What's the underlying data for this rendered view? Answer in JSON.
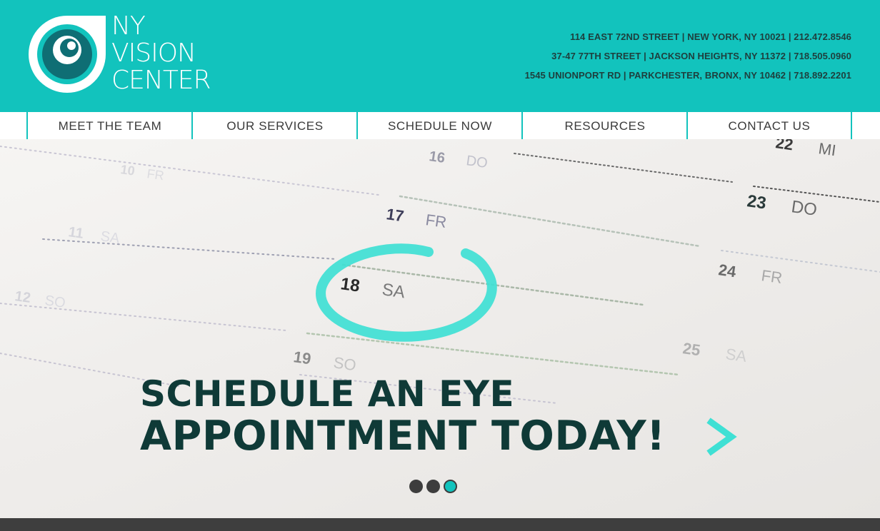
{
  "brand": {
    "line1": "NY",
    "line2": "VISION",
    "line3": "CENTER",
    "primary_color": "#12c3bd",
    "dark_teal": "#0f6e74"
  },
  "addresses": [
    "114 EAST 72ND STREET | NEW YORK, NY 10021 | 212.472.8546",
    "37-47 77TH STREET | JACKSON HEIGHTS, NY 11372 | 718.505.0960",
    "1545 UNIONPORT RD | PARKCHESTER, BRONX, NY 10462 | 718.892.2201"
  ],
  "nav": {
    "items": [
      {
        "label": "MEET THE TEAM"
      },
      {
        "label": "OUR SERVICES"
      },
      {
        "label": "SCHEDULE NOW"
      },
      {
        "label": "RESOURCES"
      },
      {
        "label": "CONTACT US"
      }
    ]
  },
  "hero": {
    "headline_line1": "SCHEDULE AN EYE",
    "headline_line2": "APPOINTMENT TODAY!",
    "headline_color": "#0f3a37",
    "next_icon": "chevron-right-icon",
    "slides_total": 3,
    "active_slide": 3,
    "calendar": {
      "d16": "16",
      "w16": "DO",
      "d17": "17",
      "w17": "FR",
      "d18": "18",
      "w18": "SA",
      "d19": "19",
      "w19": "SO",
      "d22": "22",
      "w22": "MI",
      "d23": "23",
      "w23": "DO",
      "d24": "24",
      "w24": "FR",
      "d25": "25",
      "w25": "SA",
      "d10": "10",
      "w10": "FR",
      "d11": "11",
      "w11": "SA",
      "d12": "12",
      "w12": "SO"
    }
  }
}
